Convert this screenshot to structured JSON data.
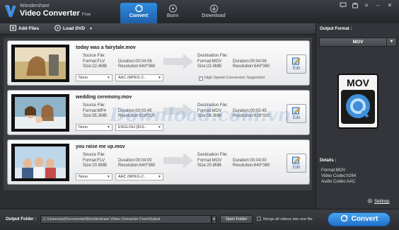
{
  "app": {
    "brand_line1": "Wondershare",
    "brand_line2": "Video Converter",
    "brand_edition": "Free"
  },
  "tabs": [
    {
      "label": "Convert",
      "active": true,
      "icon": "convert-icon"
    },
    {
      "label": "Burn",
      "active": false,
      "icon": "disc-icon"
    },
    {
      "label": "Download",
      "active": false,
      "icon": "download-icon"
    }
  ],
  "toolbar": {
    "add_files": "Add Files",
    "load_dvd": "Load DVD"
  },
  "labels": {
    "source_file": "Source File:",
    "destination_file": "Destination File:",
    "edit": "Edit",
    "high_speed": "High Speed Conversion Supported"
  },
  "files": [
    {
      "name": "today was a fairytale.mov",
      "src_format": "Format:FLV",
      "src_duration": "Duration:00:04:06",
      "src_size": "Size:22.4MB",
      "src_resolution": "Resolution:640*360",
      "dst_format": "Format:MOV",
      "dst_duration": "Duration:00:04:06",
      "dst_size": "Size:22.4MB",
      "dst_resolution": "Resolution:640*360",
      "subtitle": "None",
      "audio": "AAC (MPEG-2..."
    },
    {
      "name": "wedding ceremony.mov",
      "src_format": "Format:MP4",
      "src_duration": "Duration:00:03:45",
      "src_size": "Size:55.3MB",
      "src_resolution": "Resolution:618*320",
      "dst_format": "Format:MOV",
      "dst_duration": "Duration:00:03:45",
      "dst_size": "Size:56.3MB",
      "dst_resolution": "Resolution:618*320",
      "subtitle": "None",
      "audio": "ENGLISH [819..."
    },
    {
      "name": "you raise me up.mov",
      "src_format": "Format:FLV",
      "src_duration": "Duration:00:04:00",
      "src_size": "Size:20.9MB",
      "src_resolution": "Resolution:640*360",
      "dst_format": "Format:MOV",
      "dst_duration": "Duration:00:04:00",
      "dst_size": "Size:20.9MB",
      "dst_resolution": "Resolution:640*360",
      "subtitle": "None",
      "audio": "AAC (MPEG-2..."
    }
  ],
  "right_panel": {
    "output_format_label": "Output Format :",
    "format_value": "MOV",
    "icon_text": "MOV",
    "details_label": "Details :",
    "detail_format": "Format:MOV",
    "detail_video_codec": "Video Codec:h264",
    "detail_audio_codec": "Audio Codec:AAC",
    "settings": "Settings"
  },
  "bottom": {
    "output_folder_label": "Output Folder :",
    "output_path": "C:\\Users\\ws\\Documents\\Wondershare Video Converter Free\\Output",
    "open_folder": "Open Folder",
    "merge": "Merge all videos into one file",
    "convert": "Convert"
  },
  "watermark": "Download.com.vn",
  "colors": {
    "accent": "#2f8ce0",
    "background": "#2b2d31"
  }
}
